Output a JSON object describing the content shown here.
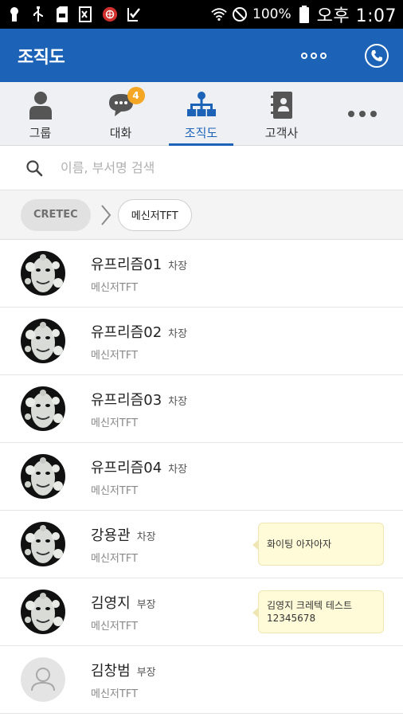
{
  "statusbar": {
    "battery_text": "100%",
    "time": "오후 1:07"
  },
  "appbar": {
    "title": "조직도"
  },
  "tabs": [
    {
      "label": "그룹",
      "icon": "person-icon"
    },
    {
      "label": "대화",
      "icon": "chat-icon",
      "badge": "4"
    },
    {
      "label": "조직도",
      "icon": "org-chart-icon",
      "active": true
    },
    {
      "label": "고객사",
      "icon": "address-book-icon"
    }
  ],
  "search": {
    "placeholder": "이름, 부서명 검색"
  },
  "breadcrumb": {
    "root": "CRETEC",
    "current": "메신저TFT"
  },
  "members": [
    {
      "name": "유프리즘01",
      "rank": "차장",
      "dept": "메신저TFT",
      "avatar": "photo"
    },
    {
      "name": "유프리즘02",
      "rank": "차장",
      "dept": "메신저TFT",
      "avatar": "photo"
    },
    {
      "name": "유프리즘03",
      "rank": "차장",
      "dept": "메신저TFT",
      "avatar": "photo"
    },
    {
      "name": "유프리즘04",
      "rank": "차장",
      "dept": "메신저TFT",
      "avatar": "photo"
    },
    {
      "name": "강용관",
      "rank": "차장",
      "dept": "메신저TFT",
      "avatar": "photo",
      "memo": [
        "화이팅 아자아자"
      ]
    },
    {
      "name": "김영지",
      "rank": "부장",
      "dept": "메신저TFT",
      "avatar": "photo",
      "memo": [
        "김영지 크레텍 테스트",
        "12345678"
      ]
    },
    {
      "name": "김창범",
      "rank": "부장",
      "dept": "메신저TFT",
      "avatar": "default"
    }
  ],
  "colors": {
    "primary": "#1c63b8",
    "badge": "#f5a623",
    "memo_bg": "#fffbd8"
  }
}
